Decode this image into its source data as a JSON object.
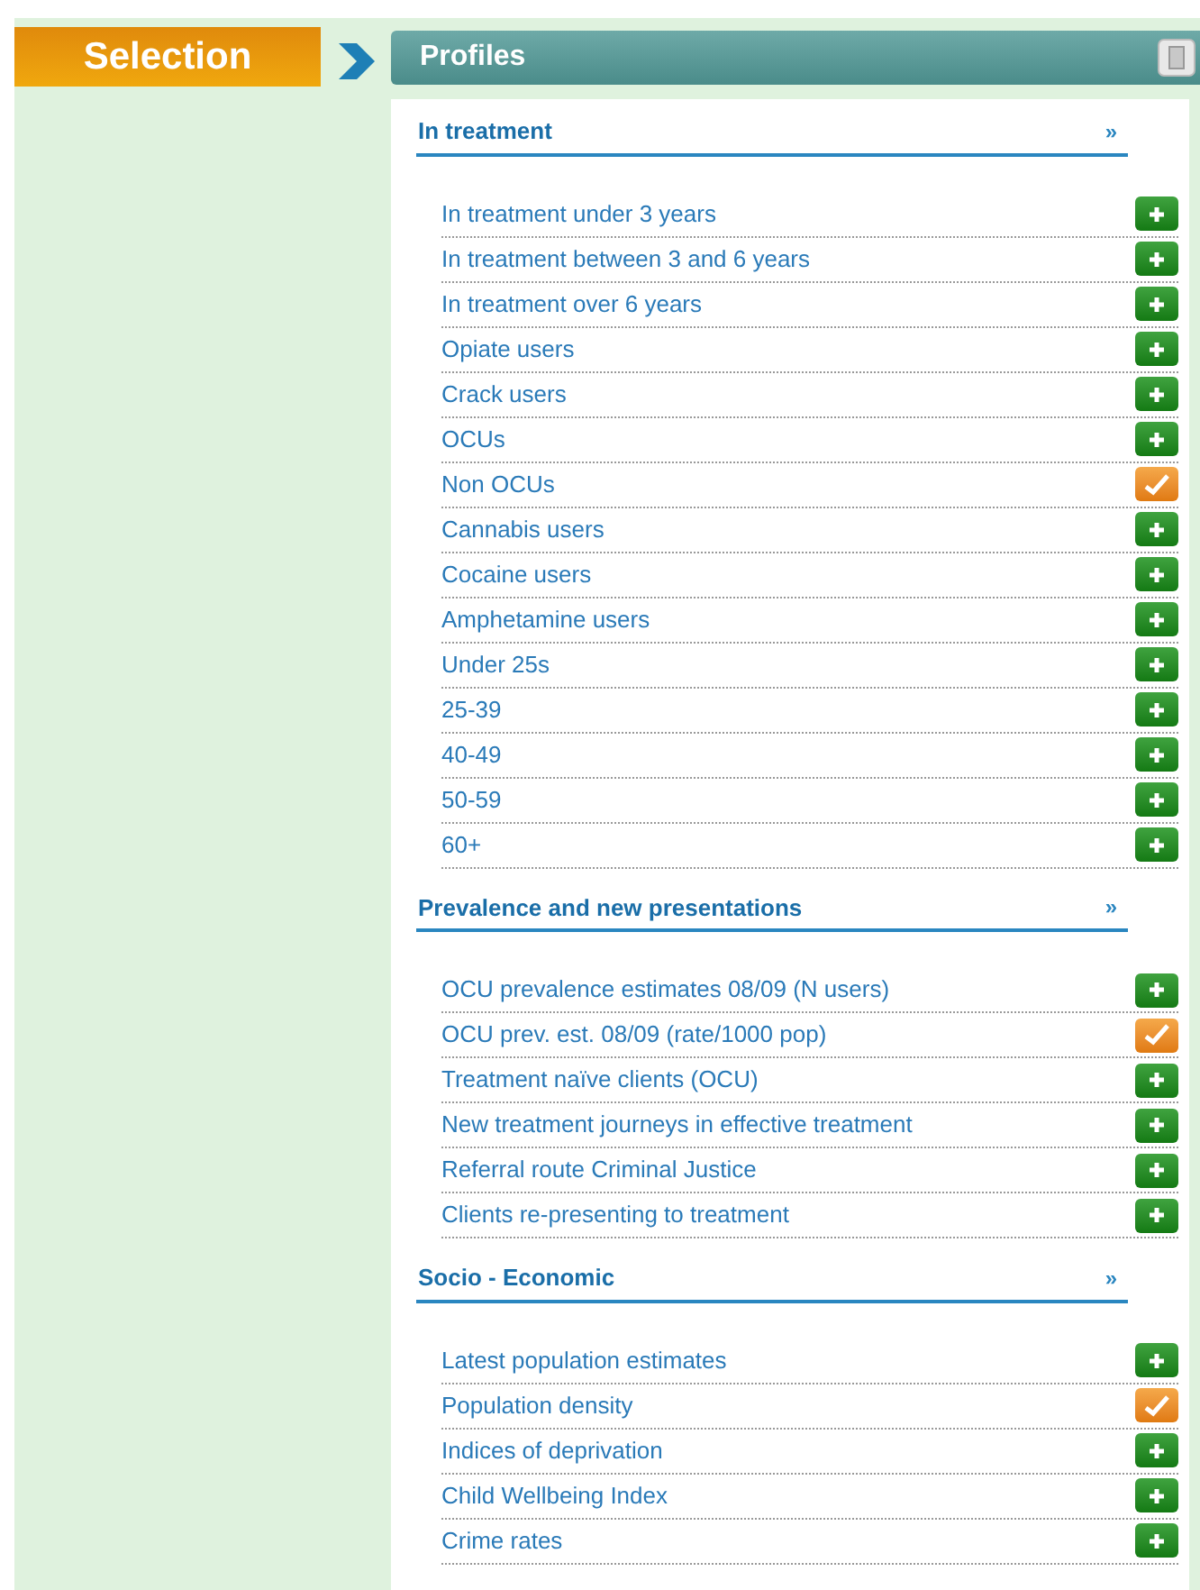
{
  "sidebar": {
    "title": "Selection"
  },
  "panel": {
    "title": "Profiles"
  },
  "sections": [
    {
      "title": "In treatment",
      "more": "»",
      "items": [
        {
          "label": "In treatment under 3 years",
          "selected": false
        },
        {
          "label": "In treatment between 3 and 6 years",
          "selected": false
        },
        {
          "label": "In treatment over 6 years",
          "selected": false
        },
        {
          "label": "Opiate users",
          "selected": false
        },
        {
          "label": "Crack users",
          "selected": false
        },
        {
          "label": "OCUs",
          "selected": false
        },
        {
          "label": "Non OCUs",
          "selected": true
        },
        {
          "label": "Cannabis users",
          "selected": false
        },
        {
          "label": "Cocaine users",
          "selected": false
        },
        {
          "label": "Amphetamine users",
          "selected": false
        },
        {
          "label": "Under 25s",
          "selected": false
        },
        {
          "label": "25-39",
          "selected": false
        },
        {
          "label": "40-49",
          "selected": false
        },
        {
          "label": "50-59",
          "selected": false
        },
        {
          "label": "60+",
          "selected": false
        }
      ]
    },
    {
      "title": "Prevalence and new presentations",
      "more": "»",
      "items": [
        {
          "label": "OCU prevalence estimates 08/09 (N users)",
          "selected": false
        },
        {
          "label": "OCU prev. est. 08/09 (rate/1000 pop)",
          "selected": true
        },
        {
          "label": "Treatment naïve clients (OCU)",
          "selected": false
        },
        {
          "label": "New treatment journeys in effective treatment",
          "selected": false
        },
        {
          "label": "Referral route Criminal Justice",
          "selected": false
        },
        {
          "label": "Clients re-presenting to treatment",
          "selected": false
        }
      ]
    },
    {
      "title": "Socio - Economic",
      "more": "»",
      "items": [
        {
          "label": "Latest population estimates",
          "selected": false
        },
        {
          "label": "Population density",
          "selected": true
        },
        {
          "label": "Indices of deprivation",
          "selected": false
        },
        {
          "label": "Child Wellbeing Index",
          "selected": false
        },
        {
          "label": "Crime rates",
          "selected": false
        }
      ]
    }
  ]
}
